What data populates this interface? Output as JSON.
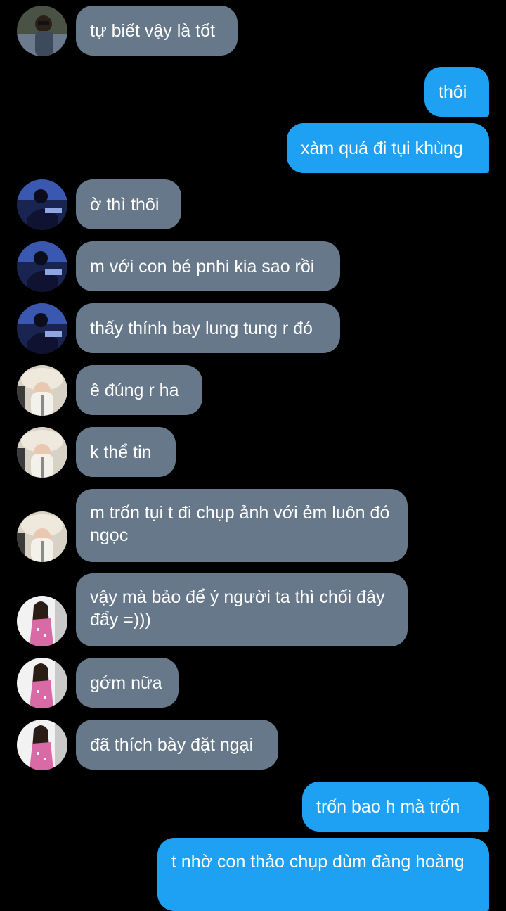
{
  "messages": [
    {
      "id": "m1",
      "side": "in",
      "sender": "friend-a",
      "text": "tự biết vậy là tốt"
    },
    {
      "id": "m2",
      "side": "out",
      "text": "thôi"
    },
    {
      "id": "m3",
      "side": "out",
      "text": "xàm quá đi tụi khùng"
    },
    {
      "id": "m4",
      "side": "in",
      "sender": "friend-b",
      "text": "ờ thì thôi"
    },
    {
      "id": "m5",
      "side": "in",
      "sender": "friend-b",
      "text": "m với con bé pnhi kia sao rồi"
    },
    {
      "id": "m6",
      "side": "in",
      "sender": "friend-b",
      "text": "thấy thính bay lung tung r đó"
    },
    {
      "id": "m7",
      "side": "in",
      "sender": "friend-c",
      "text": "ê đúng r ha"
    },
    {
      "id": "m8",
      "side": "in",
      "sender": "friend-c",
      "text": "k thể tin"
    },
    {
      "id": "m9",
      "side": "in",
      "sender": "friend-c",
      "text": "m trốn tụi t đi chụp ảnh với ẻm luôn đó ngọc"
    },
    {
      "id": "m10",
      "side": "in",
      "sender": "friend-d",
      "text": "vậy mà bảo để ý người ta thì chối đây đẩy =)))"
    },
    {
      "id": "m11",
      "side": "in",
      "sender": "friend-d",
      "text": "gớm nữa"
    },
    {
      "id": "m12",
      "side": "in",
      "sender": "friend-d",
      "text": "đã thích bày đặt ngại"
    },
    {
      "id": "m13",
      "side": "out",
      "text": "trốn bao h mà trốn"
    },
    {
      "id": "m14",
      "side": "out",
      "text": "t nhờ con thảo chụp dùm đàng hoàng"
    }
  ],
  "colors": {
    "background": "#000000",
    "incoming_bubble": "#66788a",
    "outgoing_bubble": "#1ea1f2",
    "text": "#ffffff"
  }
}
